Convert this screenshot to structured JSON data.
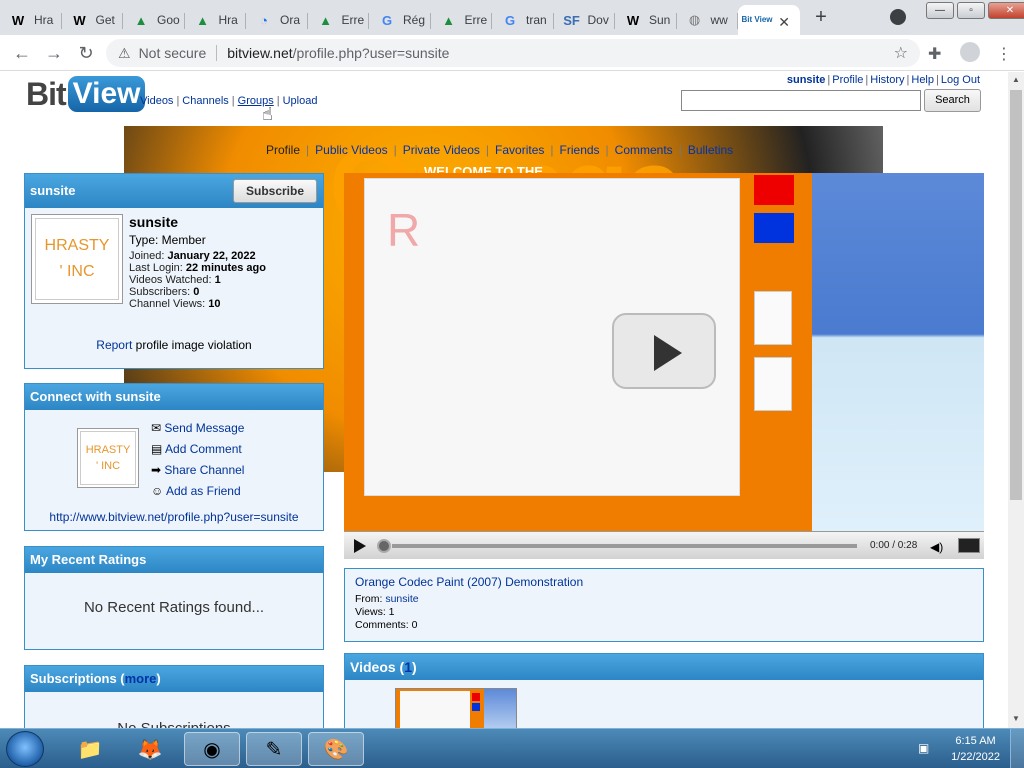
{
  "browser": {
    "tabs": [
      {
        "icon": "W",
        "title": "Hra",
        "color": "#000"
      },
      {
        "icon": "W",
        "title": "Get",
        "color": "#000"
      },
      {
        "icon": "▲",
        "title": "Goo",
        "color": "#1e8e3e"
      },
      {
        "icon": "▲",
        "title": "Hra",
        "color": "#1e8e3e"
      },
      {
        "icon": "◔",
        "title": "Ora",
        "color": "#1a73e8"
      },
      {
        "icon": "▲",
        "title": "Erre",
        "color": "#1e8e3e"
      },
      {
        "icon": "G",
        "title": "Rég",
        "color": "#4285f4"
      },
      {
        "icon": "▲",
        "title": "Erre",
        "color": "#1e8e3e"
      },
      {
        "icon": "G",
        "title": "tran",
        "color": "#4285f4"
      },
      {
        "icon": "SF",
        "title": "Dov",
        "color": "#3c6eb4"
      },
      {
        "icon": "W",
        "title": "Sun",
        "color": "#000"
      },
      {
        "icon": "◍",
        "title": "ww",
        "color": "#777"
      }
    ],
    "active_tab_icon": "Bit View",
    "active_tab_close": "✕",
    "new_tab": "+",
    "window_buttons": {
      "minimize": "—",
      "restore": "▫",
      "close": "✕"
    },
    "not_secure": "Not secure",
    "url_host": "bitview.net",
    "url_rest": "/profile.php?user=sunsite"
  },
  "site": {
    "logo_bit": "Bit",
    "logo_view": "View",
    "nav": [
      "Videos",
      "Channels",
      "Groups",
      "Upload"
    ],
    "user_links": {
      "username": "sunsite",
      "items": [
        "Profile",
        "History",
        "Help",
        "Log Out"
      ]
    },
    "search_button": "Search"
  },
  "channel_nav": [
    "Profile",
    "Public Videos",
    "Private Videos",
    "Favorites",
    "Friends",
    "Comments",
    "Bulletins"
  ],
  "banner_text": "Orange",
  "banner_welcome": "WELCOME TO THE",
  "profile_box": {
    "header": "sunsite",
    "subscribe": "Subscribe",
    "name": "sunsite",
    "type": "Type: Member",
    "joined_label": "Joined:",
    "joined": "January 22, 2022",
    "last_login_label": "Last Login:",
    "last_login": "22 minutes ago",
    "videos_watched_label": "Videos Watched:",
    "videos_watched": "1",
    "subscribers_label": "Subscribers:",
    "subscribers": "0",
    "channel_views_label": "Channel Views:",
    "channel_views": "10",
    "report_link": "Report",
    "report_rest": "profile image violation",
    "avatar_line1": "HRASTY",
    "avatar_line2": "' INC"
  },
  "connect_box": {
    "header": "Connect with sunsite",
    "actions": [
      "Send Message",
      "Add Comment",
      "Share Channel",
      "Add as Friend"
    ],
    "url": "http://www.bitview.net/profile.php?user=sunsite"
  },
  "ratings_box": {
    "header": "My Recent Ratings",
    "empty": "No Recent Ratings found..."
  },
  "subs_box": {
    "header_pre": "Subscriptions (",
    "more": "more",
    "header_post": ")",
    "empty": "No Subscriptions"
  },
  "player": {
    "time": "0:00 / 0:28",
    "progress": 0
  },
  "video_info": {
    "title": "Orange Codec Paint (2007) Demonstration",
    "from_label": "From:",
    "from": "sunsite",
    "views": "Views: 1",
    "comments": "Comments: 0"
  },
  "videos_box": {
    "header_pre": "Videos (",
    "count": "1",
    "header_post": ")"
  },
  "taskbar": {
    "time": "6:15 AM",
    "date": "1/22/2022"
  }
}
